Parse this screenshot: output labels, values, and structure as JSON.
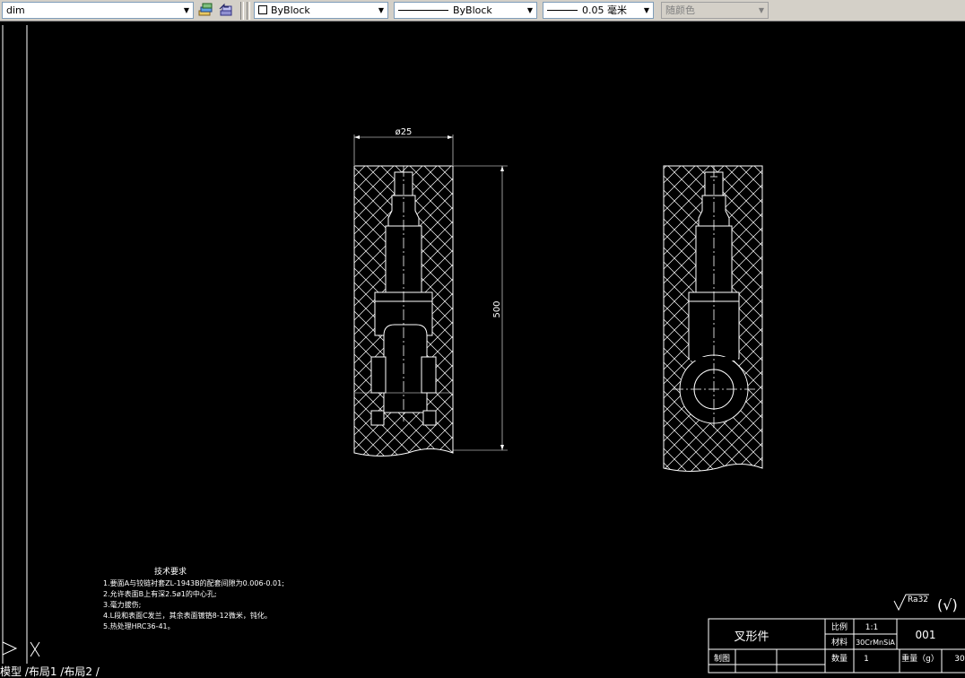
{
  "toolbar": {
    "layer_value": "dim",
    "color_value": "ByBlock",
    "linetype_value": "ByBlock",
    "lineweight_value": "0.05 毫米",
    "plotstyle_value": "随颜色"
  },
  "drawing": {
    "dim_diameter": "ø25",
    "dim_length": "500",
    "tech_notes_title": "技术要求",
    "tech_notes": [
      "1.要面A与铰链衬套ZL-1943B的配套间隙为0.006-0.01;",
      "2.允许表面B上有深2.5ø1的中心孔;",
      "3.毫力拔伤;",
      "4.L段和表面C发兰，其余表面镀铬8-12微米，钝化。",
      "5.热处理HRC36-41。"
    ],
    "roughness": "Ra32",
    "title_block": {
      "part_name": "叉形件",
      "scale_label": "比例",
      "scale_value": "1:1",
      "material_label": "材料",
      "material_value": "30CrMnSiA",
      "drawing_no": "001",
      "drafter_label": "制图",
      "quantity_label": "数量",
      "quantity_value": "1",
      "weight_label": "重量（g）",
      "weight_value": "30"
    }
  },
  "layout_tabs": "模型 /布局1 /布局2 /"
}
